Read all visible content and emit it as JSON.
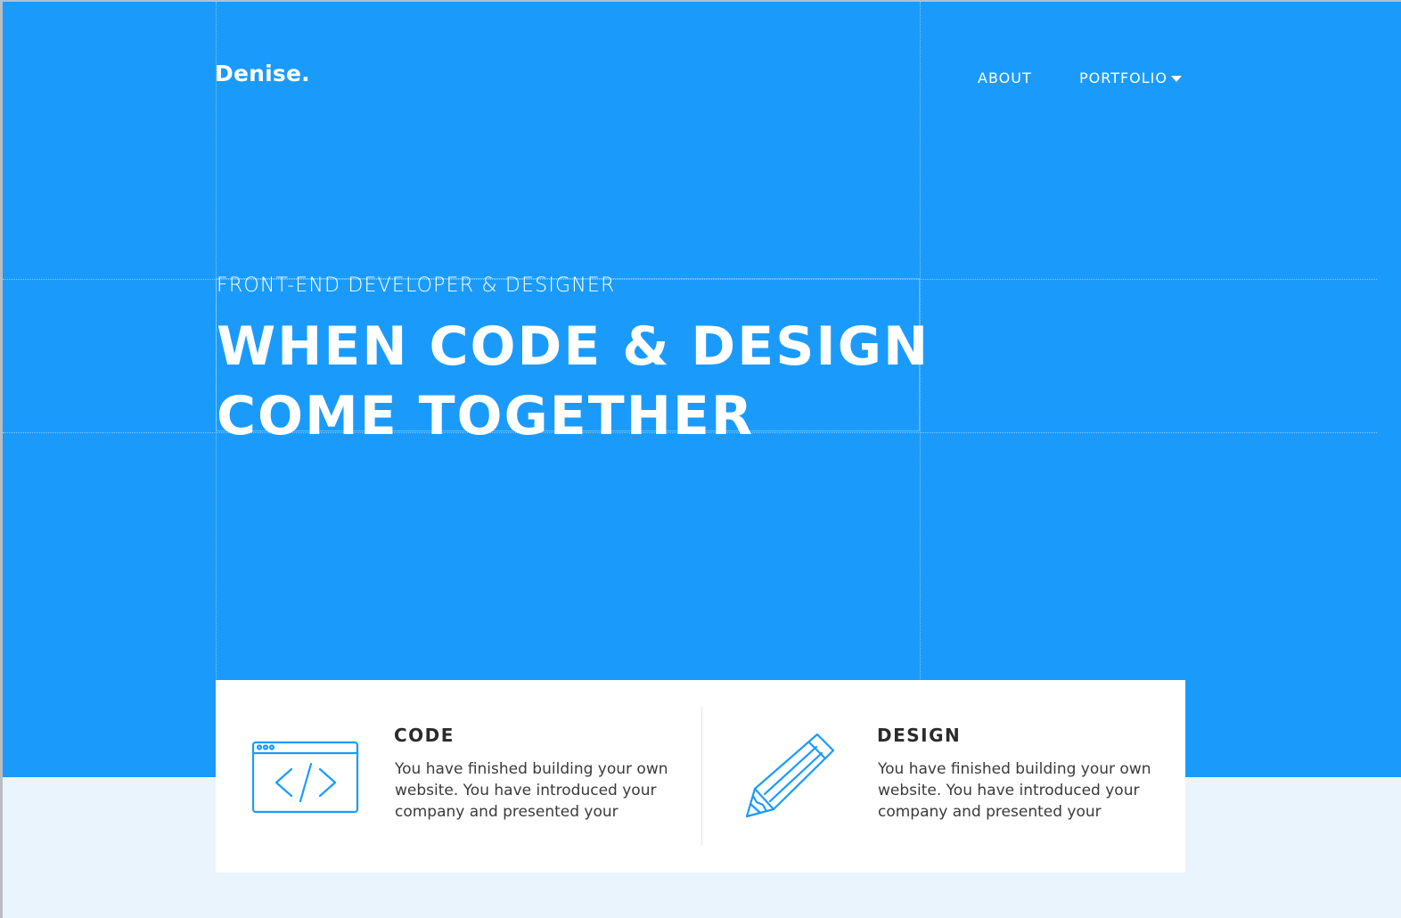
{
  "brand": {
    "logo": "Denise."
  },
  "nav": {
    "items": [
      {
        "label": "ABOUT"
      },
      {
        "label": "PORTFOLIO",
        "icon": "caret-down-icon"
      }
    ]
  },
  "hero": {
    "subtitle": "FRONT-END DEVELOPER & DESIGNER",
    "title_line_1": "WHEN CODE & DESIGN",
    "title_line_2": "COME TOGETHER"
  },
  "features": [
    {
      "icon": "code-window-icon",
      "title": "CODE",
      "text": "You have finished building your own website. You have introduced your company and presented your"
    },
    {
      "icon": "pencil-icon",
      "title": "DESIGN",
      "text": "You have finished building your own website. You have introduced your company and presented your"
    }
  ],
  "colors": {
    "hero_background": "#1a9bfc",
    "page_background": "#e9f4fd",
    "accent": "#1a9bfc",
    "card_background": "#ffffff"
  }
}
